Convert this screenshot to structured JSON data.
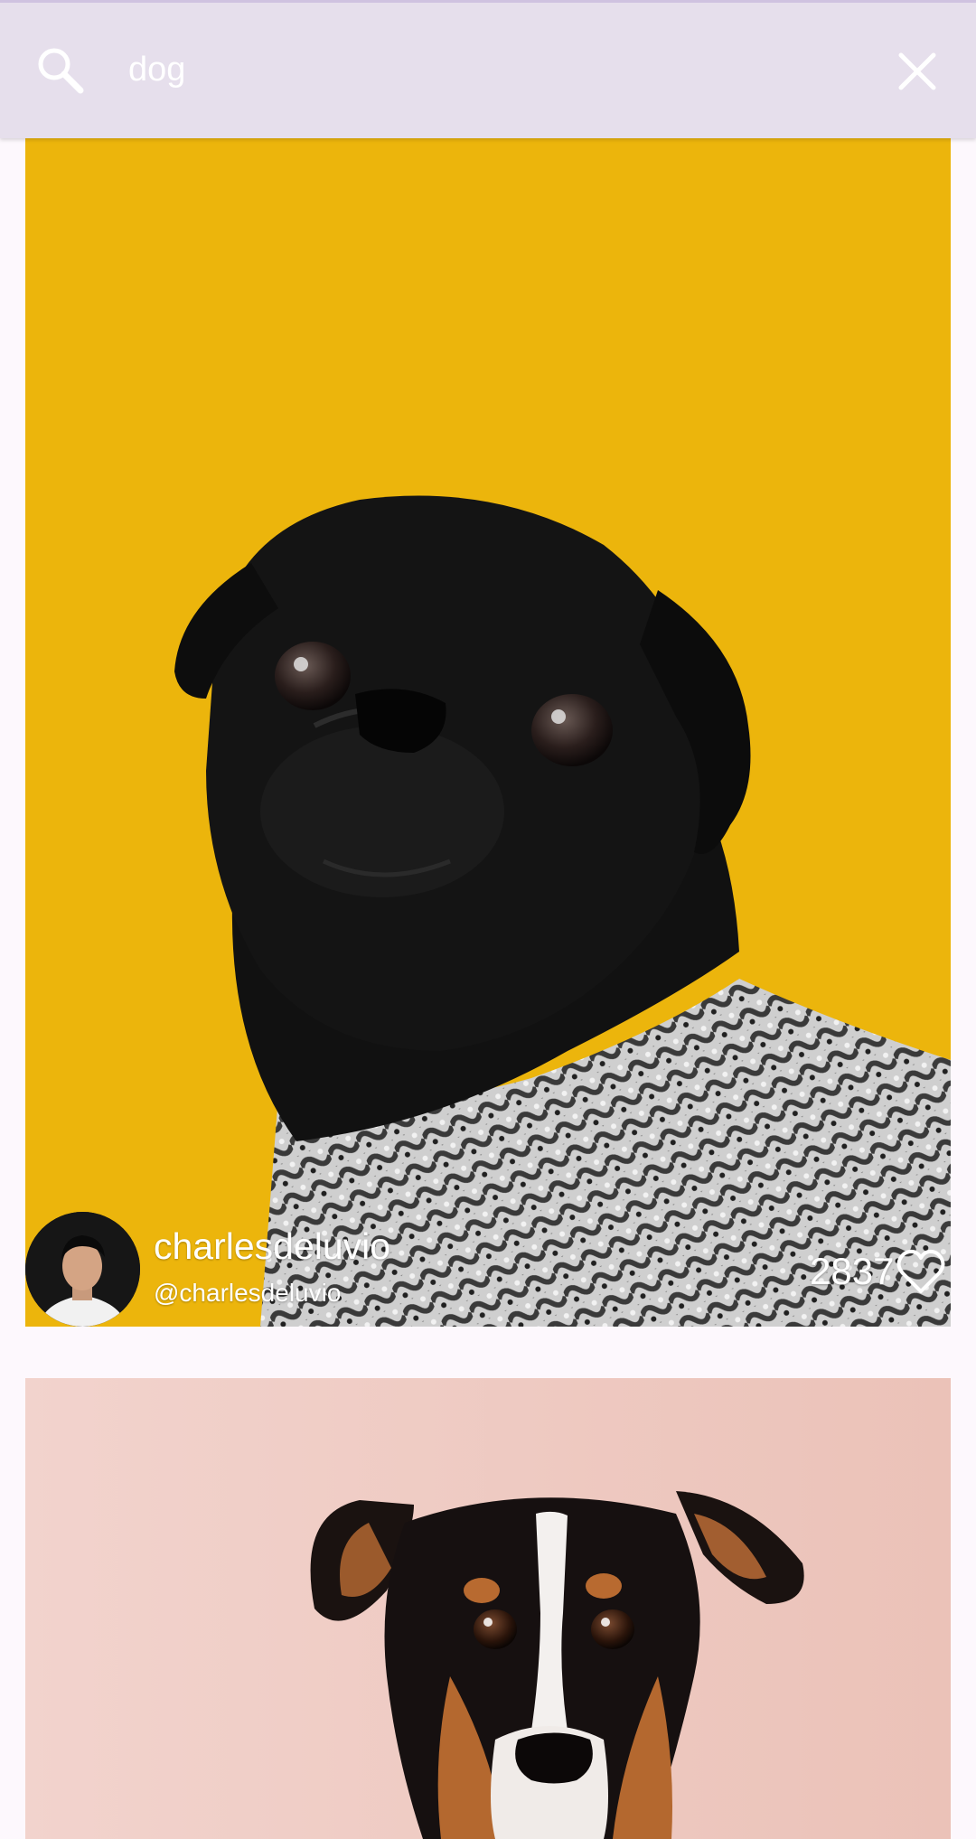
{
  "search": {
    "query": "dog",
    "search_icon": "search-icon",
    "close_icon": "close-icon"
  },
  "feed": {
    "photos": [
      {
        "subject": "Black pug in knit sweater on yellow background",
        "background_color": "#ecb50c",
        "author_name": "charlesdeluvio",
        "author_handle": "@charlesdeluvio",
        "likes": "2837",
        "like_icon": "heart-outline-icon"
      },
      {
        "subject": "Jack Russell terrier on pink background",
        "background_color": "#efd0c8"
      }
    ]
  },
  "colors": {
    "search_bar": "#e6dfec",
    "page_background": "#fdf8fd",
    "text_on_photo": "#ffffff"
  }
}
